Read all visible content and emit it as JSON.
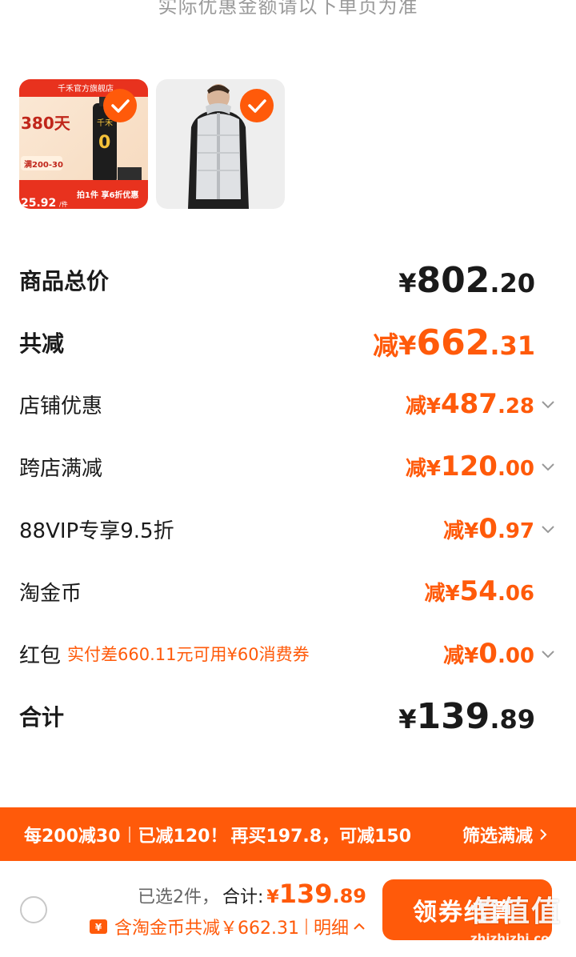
{
  "top_note": "实际优惠金额请以下单页为准",
  "products": [
    {
      "name": "千禾官方旗舰店商品",
      "image_text": {
        "shop": "千禾官方旗舰店",
        "days": "380天",
        "brand_badge": "千禾",
        "zero": "0",
        "coupon": "满200-30",
        "price": "25.92",
        "price_unit": "/件",
        "offer": "拍1件 享6折优惠"
      },
      "selected": true,
      "check_icon": "check-icon"
    },
    {
      "name": "男士羽绒马甲",
      "selected": true,
      "check_icon": "check-icon"
    }
  ],
  "summary": {
    "total": {
      "label": "商品总价",
      "currency": "¥",
      "int": "802",
      "dec": ".20"
    },
    "discount": {
      "label": "共减",
      "prefix": "减¥",
      "int": "662",
      "dec": ".31"
    },
    "lines": [
      {
        "label": "店铺优惠",
        "prefix": "减¥",
        "int": "487",
        "dec": ".28",
        "expandable": true
      },
      {
        "label": "跨店满减",
        "prefix": "减¥",
        "int": "120",
        "dec": ".00",
        "expandable": true
      },
      {
        "label": "88VIP专享9.5折",
        "prefix": "减¥",
        "int": "0",
        "dec": ".97",
        "expandable": true
      },
      {
        "label": "淘金币",
        "prefix": "减¥",
        "int": "54",
        "dec": ".06",
        "expandable": false
      },
      {
        "label": "红包",
        "hint": "实付差660.11元可用¥60消费券",
        "prefix": "减¥",
        "int": "0",
        "dec": ".00",
        "expandable": true
      }
    ],
    "grand_total": {
      "label": "合计",
      "currency": "¥",
      "int": "139",
      "dec": ".89"
    }
  },
  "promo_bar": {
    "rule": "每200减30",
    "reduced": "已减120！",
    "next": "再买197.8，可减150",
    "filter": "筛选满减"
  },
  "bottom_bar": {
    "selected_count": "已选2件，",
    "total_label": "合计:",
    "currency": "¥",
    "total_int": "139",
    "total_dec": ".89",
    "savings": "含淘金币共减￥662.31",
    "detail": "明细",
    "checkout": "领券结算"
  },
  "watermark": {
    "cn": "值值值",
    "en": "zhizhizhi.com"
  },
  "colors": {
    "accent": "#ff5a0a",
    "text": "#1a1a1a",
    "muted": "#9a9a9a"
  }
}
